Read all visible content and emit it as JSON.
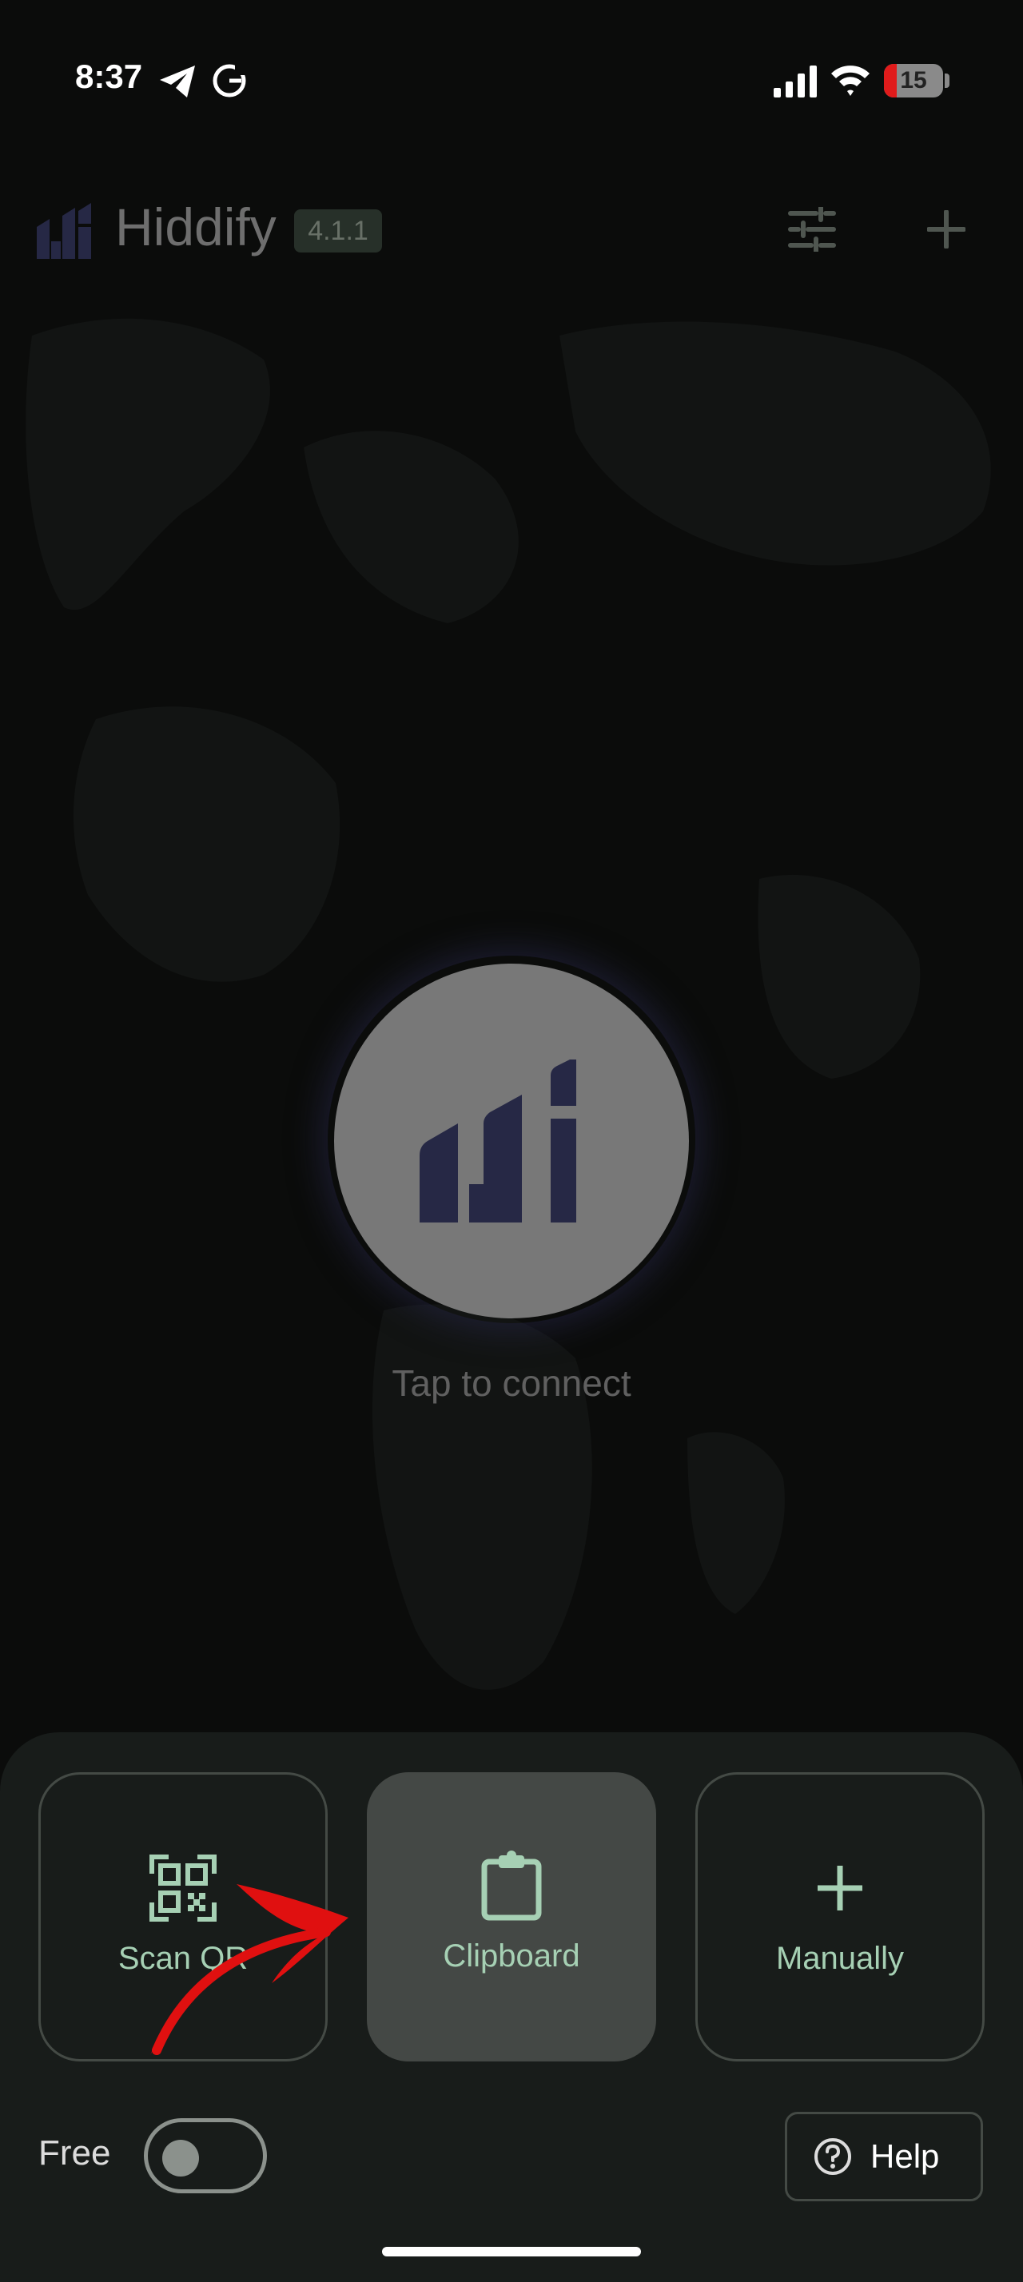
{
  "status_bar": {
    "time": "8:37",
    "battery_level": "15",
    "icons": [
      "telegram-icon",
      "grammarly-icon",
      "cellular-signal-icon",
      "wifi-icon",
      "battery-icon"
    ]
  },
  "header": {
    "app_name": "Hiddify",
    "version": "4.1.1",
    "icons": [
      "hiddify-logo-icon",
      "settings-sliders-icon",
      "add-icon"
    ]
  },
  "connect": {
    "label": "Tap to connect",
    "icon": "hiddify-logo-icon"
  },
  "add_profile": {
    "actions": [
      {
        "label": "Scan QR",
        "icon": "qr-code-icon"
      },
      {
        "label": "Clipboard",
        "icon": "clipboard-icon"
      },
      {
        "label": "Manually",
        "icon": "plus-icon"
      }
    ]
  },
  "footer": {
    "free_label": "Free",
    "free_toggle_on": false,
    "help_label": "Help",
    "help_icon": "help-circle-icon"
  },
  "colors": {
    "accent": "#a6d0b4",
    "annotation": "#e01010",
    "logo": "#262845"
  }
}
